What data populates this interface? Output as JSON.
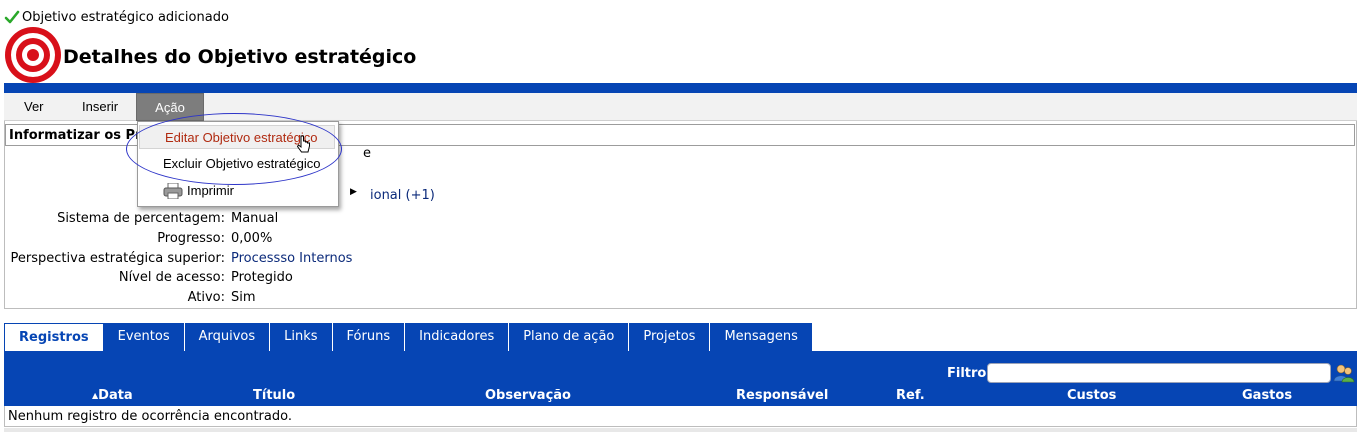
{
  "notice": {
    "text": "Objetivo estratégico adicionado"
  },
  "page": {
    "title": "Detalhes do Objetivo estratégico"
  },
  "menu": {
    "items": [
      "Ver",
      "Inserir",
      "Ação"
    ]
  },
  "dropdown": {
    "items": [
      {
        "label": "Editar Objetivo estratégico",
        "state": "hover"
      },
      {
        "label": "Excluir Objetivo estratégico"
      },
      {
        "label": "Imprimir",
        "has_submenu": true
      }
    ]
  },
  "details": {
    "header": "Informatizar os Pr",
    "partial_value_1": "e",
    "partial_value_2": "ional (+1)",
    "fields": [
      {
        "label": "Sistema de percentagem:",
        "value": "Manual"
      },
      {
        "label": "Progresso:",
        "value": "0,00%"
      },
      {
        "label": "Perspectiva estratégica superior:",
        "value": "Processso Internos"
      },
      {
        "label": "Nível de acesso:",
        "value": "Protegido"
      },
      {
        "label": "Ativo:",
        "value": "Sim"
      }
    ]
  },
  "tabs": {
    "items": [
      "Registros",
      "Eventos",
      "Arquivos",
      "Links",
      "Fóruns",
      "Indicadores",
      "Plano de ação",
      "Projetos",
      "Mensagens"
    ],
    "active": "Registros"
  },
  "registros": {
    "filter_label": "Filtro",
    "filter_value": "",
    "columns": [
      "Data",
      "Título",
      "Observação",
      "Responsável",
      "Ref.",
      "Custos",
      "Gastos"
    ],
    "sort_column": "Data",
    "empty_message": "Nenhum registro de ocorrência encontrado."
  },
  "colors": {
    "accent": "#0645b4",
    "menu_active": "#7d7d7d",
    "hover_text": "#b02a10",
    "annotation": "#2e35c8"
  }
}
